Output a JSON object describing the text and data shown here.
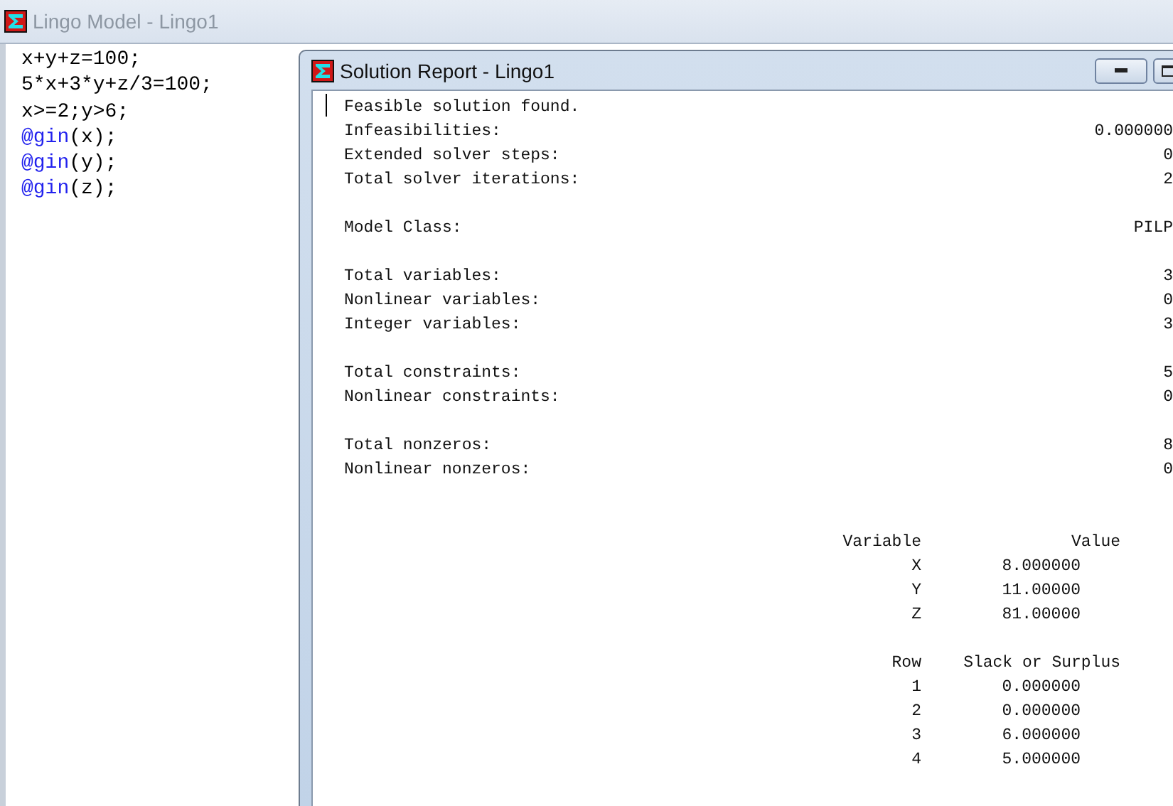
{
  "window": {
    "title": "Lingo Model - Lingo1"
  },
  "editor": {
    "lines": [
      {
        "segments": [
          {
            "kind": "plain",
            "text": "x+y+z=100;"
          }
        ]
      },
      {
        "segments": [
          {
            "kind": "plain",
            "text": "5*x+3*y+z/3=100;"
          }
        ]
      },
      {
        "segments": [
          {
            "kind": "plain",
            "text": "x>=2;y>6;"
          }
        ]
      },
      {
        "segments": [
          {
            "kind": "keyword",
            "text": "@gin"
          },
          {
            "kind": "plain",
            "text": "(x);"
          }
        ]
      },
      {
        "segments": [
          {
            "kind": "keyword",
            "text": "@gin"
          },
          {
            "kind": "plain",
            "text": "(y);"
          }
        ]
      },
      {
        "segments": [
          {
            "kind": "keyword",
            "text": "@gin"
          },
          {
            "kind": "plain",
            "text": "(z);"
          }
        ]
      }
    ]
  },
  "report": {
    "title": "Solution Report - Lingo1",
    "blocks": [
      {
        "kind": "message",
        "text": "Feasible solution found."
      },
      {
        "kind": "stats",
        "rows": [
          {
            "label": "Infeasibilities:",
            "value": "0.000000"
          },
          {
            "label": "Extended solver steps:",
            "value": "0"
          },
          {
            "label": "Total solver iterations:",
            "value": "2"
          }
        ]
      },
      {
        "kind": "stats",
        "rows": [
          {
            "label": "Model Class:",
            "value": "PILP"
          }
        ]
      },
      {
        "kind": "counts",
        "rows": [
          {
            "label": "Total variables:",
            "value": "3"
          },
          {
            "label": "Nonlinear variables:",
            "value": "0"
          },
          {
            "label": "Integer variables:",
            "value": "3"
          }
        ]
      },
      {
        "kind": "counts",
        "rows": [
          {
            "label": "Total constraints:",
            "value": "5"
          },
          {
            "label": "Nonlinear constraints:",
            "value": "0"
          }
        ]
      },
      {
        "kind": "counts",
        "rows": [
          {
            "label": "Total nonzeros:",
            "value": "8"
          },
          {
            "label": "Nonlinear nonzeros:",
            "value": "0"
          }
        ]
      },
      {
        "kind": "table",
        "columns": [
          "Variable",
          "Value"
        ],
        "rows": [
          [
            "X",
            "8.000000"
          ],
          [
            "Y",
            "11.00000"
          ],
          [
            "Z",
            "81.00000"
          ]
        ]
      },
      {
        "kind": "table",
        "columns": [
          "Row",
          "Slack or Surplus"
        ],
        "rows": [
          [
            "1",
            "0.000000"
          ],
          [
            "2",
            "0.000000"
          ],
          [
            "3",
            "6.000000"
          ],
          [
            "4",
            "5.000000"
          ]
        ]
      }
    ]
  }
}
